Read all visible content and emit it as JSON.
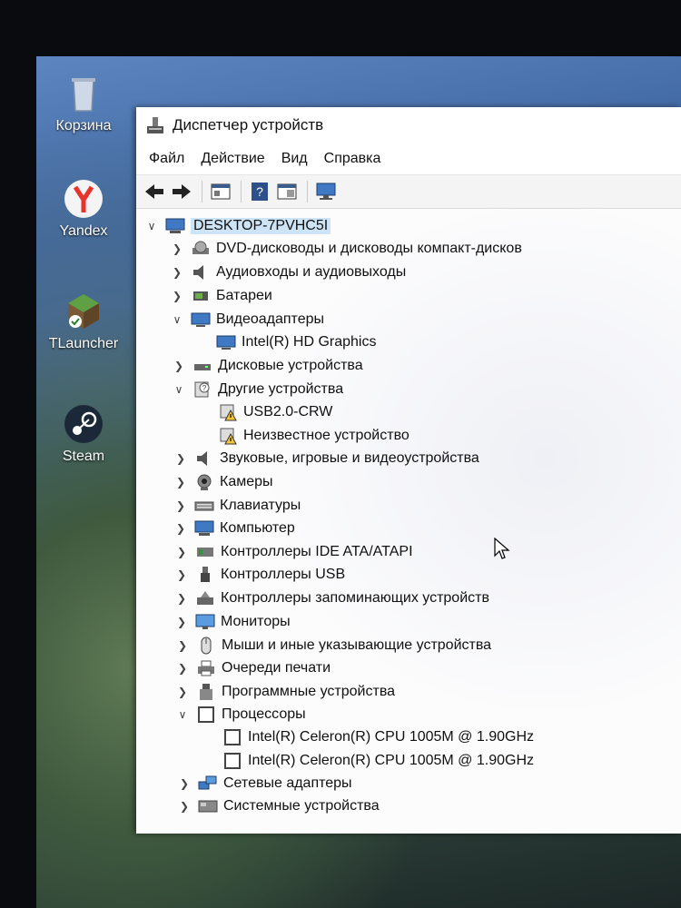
{
  "desktop": {
    "icons": [
      {
        "label": "Корзина",
        "icon": "recycle-bin-icon"
      },
      {
        "label": "Yandex",
        "icon": "yandex-browser-icon"
      },
      {
        "label": "TLauncher",
        "icon": "tlauncher-icon"
      },
      {
        "label": "Steam",
        "icon": "steam-icon"
      }
    ]
  },
  "window": {
    "title": "Диспетчер устройств",
    "menu": [
      "Файл",
      "Действие",
      "Вид",
      "Справка"
    ],
    "toolbar": [
      "back-icon",
      "forward-icon",
      "properties-icon",
      "help-icon",
      "view-icon",
      "monitor-scan-icon"
    ]
  },
  "tree": {
    "root": "DESKTOP-7PVHC5I",
    "items": [
      {
        "label": "DVD-дисководы и дисководы компакт-дисков",
        "expanded": false,
        "icon": "dvd-icon"
      },
      {
        "label": "Аудиовходы и аудиовыходы",
        "expanded": false,
        "icon": "speaker-icon"
      },
      {
        "label": "Батареи",
        "expanded": false,
        "icon": "battery-icon"
      },
      {
        "label": "Видеоадаптеры",
        "expanded": true,
        "icon": "display-adapter-icon",
        "children": [
          {
            "label": "Intel(R) HD Graphics",
            "icon": "display-adapter-icon"
          }
        ]
      },
      {
        "label": "Дисковые устройства",
        "expanded": false,
        "icon": "disk-icon"
      },
      {
        "label": "Другие устройства",
        "expanded": true,
        "icon": "unknown-device-icon",
        "children": [
          {
            "label": "USB2.0-CRW",
            "icon": "warning-device-icon"
          },
          {
            "label": "Неизвестное устройство",
            "icon": "warning-device-icon"
          }
        ]
      },
      {
        "label": "Звуковые, игровые и видеоустройства",
        "expanded": false,
        "icon": "sound-icon"
      },
      {
        "label": "Камеры",
        "expanded": false,
        "icon": "camera-icon"
      },
      {
        "label": "Клавиатуры",
        "expanded": false,
        "icon": "keyboard-icon"
      },
      {
        "label": "Компьютер",
        "expanded": false,
        "icon": "computer-icon"
      },
      {
        "label": "Контроллеры IDE ATA/ATAPI",
        "expanded": false,
        "icon": "ide-controller-icon"
      },
      {
        "label": "Контроллеры USB",
        "expanded": false,
        "icon": "usb-icon"
      },
      {
        "label": "Контроллеры запоминающих устройств",
        "expanded": false,
        "icon": "storage-controller-icon"
      },
      {
        "label": "Мониторы",
        "expanded": false,
        "icon": "monitor-icon"
      },
      {
        "label": "Мыши и иные указывающие устройства",
        "expanded": false,
        "icon": "mouse-icon"
      },
      {
        "label": "Очереди печати",
        "expanded": false,
        "icon": "printer-icon"
      },
      {
        "label": "Программные устройства",
        "expanded": false,
        "icon": "software-device-icon"
      },
      {
        "label": "Процессоры",
        "expanded": true,
        "icon": "processor-icon",
        "children": [
          {
            "label": "Intel(R) Celeron(R) CPU 1005M @ 1.90GHz",
            "icon": "processor-icon"
          },
          {
            "label": "Intel(R) Celeron(R) CPU 1005M @ 1.90GHz",
            "icon": "processor-icon"
          }
        ]
      },
      {
        "label": "Сетевые адаптеры",
        "expanded": false,
        "icon": "network-icon"
      },
      {
        "label": "Системные устройства",
        "expanded": false,
        "icon": "system-device-icon"
      }
    ]
  }
}
